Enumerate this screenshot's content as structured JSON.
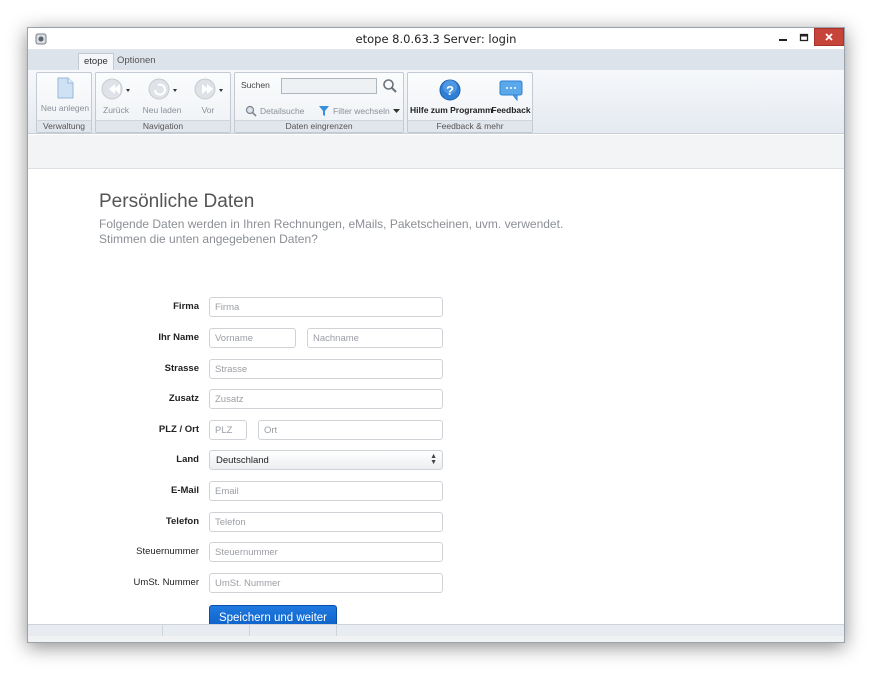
{
  "window": {
    "title": "etope 8.0.63.3 Server: login"
  },
  "ribbon": {
    "tabs": [
      {
        "label": "etope",
        "active": true
      },
      {
        "label": "Optionen",
        "active": false
      }
    ],
    "groups": {
      "verwaltung": {
        "label": "Verwaltung",
        "new_label": "Neu anlegen"
      },
      "navigation": {
        "label": "Navigation",
        "back_label": "Zurück",
        "reload_label": "Neu laden",
        "forward_label": "Vor"
      },
      "filter": {
        "label": "Daten eingrenzen",
        "search_label": "Suchen",
        "search_value": "",
        "detail_label": "Detailsuche",
        "filter_label": "Filter wechseln"
      },
      "feedback": {
        "label": "Feedback & mehr",
        "help_label": "Hilfe zum Programm",
        "feedback_label": "Feedback"
      }
    }
  },
  "page": {
    "title": "Persönliche Daten",
    "subtitle_1": "Folgende Daten werden in Ihren Rechnungen, eMails, Paketscheinen, uvm. verwendet.",
    "subtitle_2": "Stimmen die unten angegebenen Daten?"
  },
  "form": {
    "firma": {
      "label": "Firma",
      "placeholder": "Firma"
    },
    "name": {
      "label": "Ihr Name",
      "first_placeholder": "Vorname",
      "last_placeholder": "Nachname"
    },
    "strasse": {
      "label": "Strasse",
      "placeholder": "Strasse"
    },
    "zusatz": {
      "label": "Zusatz",
      "placeholder": "Zusatz"
    },
    "plzort": {
      "label": "PLZ / Ort",
      "plz_placeholder": "PLZ",
      "ort_placeholder": "Ort"
    },
    "land": {
      "label": "Land",
      "value": "Deutschland"
    },
    "email": {
      "label": "E-Mail",
      "placeholder": "Email"
    },
    "telefon": {
      "label": "Telefon",
      "placeholder": "Telefon"
    },
    "steuer": {
      "label": "Steuernummer",
      "placeholder": "Steuernummer"
    },
    "ustnr": {
      "label": "UmSt. Nummer",
      "placeholder": "UmSt. Nummer"
    },
    "save_label": "Speichern und weiter"
  },
  "colors": {
    "accent": "#1f7ae0",
    "close": "#c7443a",
    "help": "#2f7fd6"
  }
}
